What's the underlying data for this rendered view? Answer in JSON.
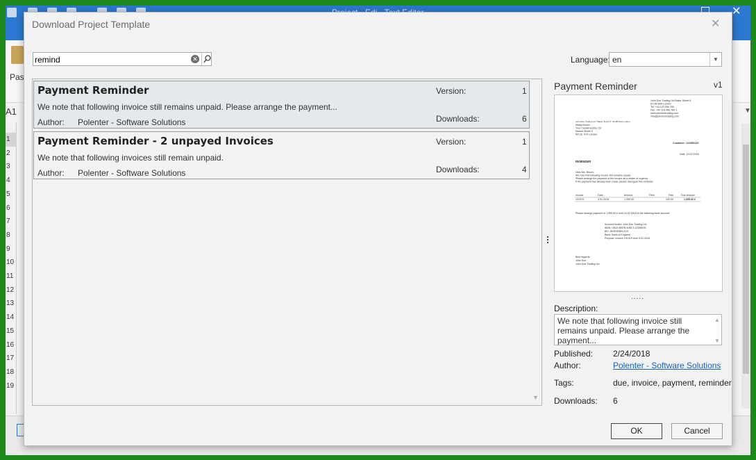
{
  "app": {
    "window_title": "Project - Edi - Text Editor",
    "paste_label": "Past",
    "namebox": "A1",
    "row_numbers": [
      "1",
      "2",
      "3",
      "4",
      "5",
      "6",
      "7",
      "8",
      "9",
      "10",
      "11",
      "12",
      "13",
      "14",
      "15",
      "16",
      "17",
      "18",
      "19"
    ]
  },
  "dialog": {
    "title": "Download Project Template",
    "search": {
      "value": "remind"
    },
    "language": {
      "label": "Language:",
      "value": "en"
    },
    "templates": [
      {
        "title": "Payment Reminder",
        "description": "We note that following invoice still remains unpaid. Please arrange the payment...",
        "author_label": "Author:",
        "author": "Polenter - Software Solutions",
        "version_label": "Version:",
        "version": "1",
        "downloads_label": "Downloads:",
        "downloads": "6",
        "selected": true
      },
      {
        "title": "Payment Reminder - 2 unpayed Invoices",
        "description": "We note that following invoices still remain unpaid.",
        "author_label": "Author:",
        "author": "Polenter - Software Solutions",
        "version_label": "Version:",
        "version": "1",
        "downloads_label": "Downloads:",
        "downloads": "4",
        "selected": false
      }
    ],
    "preview": {
      "title": "Payment Reminder",
      "version": "v1",
      "pager": ".....",
      "doc": {
        "sender": [
          "John Doe Trading Ltd Baker Street 8",
          "EC2B 8AA London",
          "Tel: +44 123 456 789",
          "Fax: +44 123 456 789 1",
          "www.johndoetrading.com",
          "info@johndoetrading.com"
        ],
        "recipient": [
          "John Doe Trading Ltd * Baker Street 8 * EC2B 8AA London",
          "Maisy Brown",
          "Your Candid Hobby Ltd",
          "Market Street 3",
          "WC1E 7HX London"
        ],
        "customer_no": "Customer: 123456123",
        "date": "Date: 19.02.2018",
        "heading": "REMINDER",
        "body": [
          "Dear Ms. Brown,",
          "We note that following invoice still remains unpaid.",
          "Please arrange the payment of the invoice as a matter of urgency.",
          "If the payment has already been made, please disregard this reminder."
        ],
        "table_header": [
          "Invoice",
          "Date",
          "Amount",
          "Fees",
          "Paid",
          "Due amount"
        ],
        "table_row": [
          "191919",
          "5.01.2018",
          "1,055.00",
          "",
          "100,00",
          "1,055,00 £"
        ],
        "payment_note": "Please arrange payment of 1,955,00 £ until 24.02.2018 to the following bank account:",
        "bank": [
          "Account holder:  John Doe Trading Ltd",
          "IBAN:  GB15 BKEN 4065 3 12345678",
          "BIC:  BKENGB2LXXX",
          "Bank:  Bank of England",
          "Purpose:  Invoice 191919 from 5.01.2018"
        ],
        "closing": [
          "Best regards",
          "John Doe",
          "John Doe Trading Ltd"
        ]
      }
    },
    "description_label": "Description:",
    "description": "We note that following invoice still remains unpaid. Please arrange the payment...",
    "published_label": "Published:",
    "published": "2/24/2018",
    "author_label": "Author:",
    "author": "Polenter - Software Solutions",
    "tags_label": "Tags:",
    "tags": "due, invoice, payment, reminder",
    "downloads_label": "Downloads:",
    "downloads": "6",
    "ok_label": "OK",
    "cancel_label": "Cancel"
  },
  "colors": {
    "frame_green": "#1e8a1e",
    "title_blue": "#2b78d1",
    "link_blue": "#1a5fb4",
    "selected_row": "#e4e9ec"
  }
}
